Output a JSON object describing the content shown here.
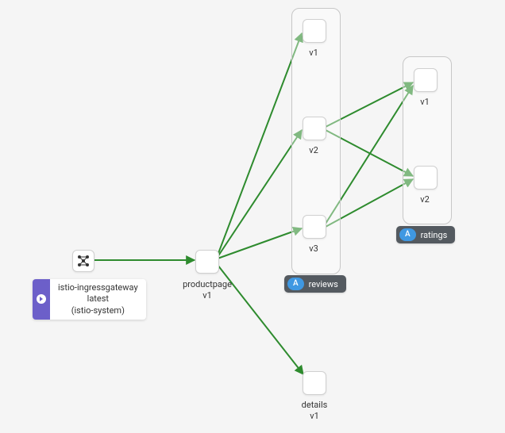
{
  "gateway": {
    "name": "istio-ingressgateway",
    "version": "latest",
    "namespace": "(istio-system)"
  },
  "nodes": {
    "productpage": {
      "name": "productpage",
      "version": "v1"
    },
    "reviews": {
      "groupLabel": "reviews",
      "badge": "A",
      "versions": {
        "v1": "v1",
        "v2": "v2",
        "v3": "v3"
      }
    },
    "ratings": {
      "groupLabel": "ratings",
      "badge": "A",
      "versions": {
        "v1": "v1",
        "v2": "v2"
      }
    },
    "details": {
      "name": "details",
      "version": "v1"
    }
  },
  "chart_data": {
    "type": "graph",
    "title": "",
    "nodes": [
      {
        "id": "istio-ingressgateway",
        "label": "istio-ingressgateway latest (istio-system)",
        "kind": "gateway"
      },
      {
        "id": "productpage-v1",
        "label": "productpage v1",
        "kind": "workload"
      },
      {
        "id": "reviews",
        "label": "reviews",
        "kind": "app-group",
        "children": [
          "reviews-v1",
          "reviews-v2",
          "reviews-v3"
        ]
      },
      {
        "id": "reviews-v1",
        "label": "v1",
        "kind": "workload"
      },
      {
        "id": "reviews-v2",
        "label": "v2",
        "kind": "workload"
      },
      {
        "id": "reviews-v3",
        "label": "v3",
        "kind": "workload"
      },
      {
        "id": "ratings",
        "label": "ratings",
        "kind": "app-group",
        "children": [
          "ratings-v1",
          "ratings-v2"
        ]
      },
      {
        "id": "ratings-v1",
        "label": "v1",
        "kind": "workload"
      },
      {
        "id": "ratings-v2",
        "label": "v2",
        "kind": "workload"
      },
      {
        "id": "details-v1",
        "label": "details v1",
        "kind": "workload"
      }
    ],
    "edges": [
      {
        "from": "istio-ingressgateway",
        "to": "productpage-v1"
      },
      {
        "from": "productpage-v1",
        "to": "reviews-v1"
      },
      {
        "from": "productpage-v1",
        "to": "reviews-v2"
      },
      {
        "from": "productpage-v1",
        "to": "reviews-v3"
      },
      {
        "from": "productpage-v1",
        "to": "details-v1"
      },
      {
        "from": "reviews-v2",
        "to": "ratings-v1"
      },
      {
        "from": "reviews-v2",
        "to": "ratings-v2"
      },
      {
        "from": "reviews-v3",
        "to": "ratings-v1"
      },
      {
        "from": "reviews-v3",
        "to": "ratings-v2"
      }
    ]
  }
}
